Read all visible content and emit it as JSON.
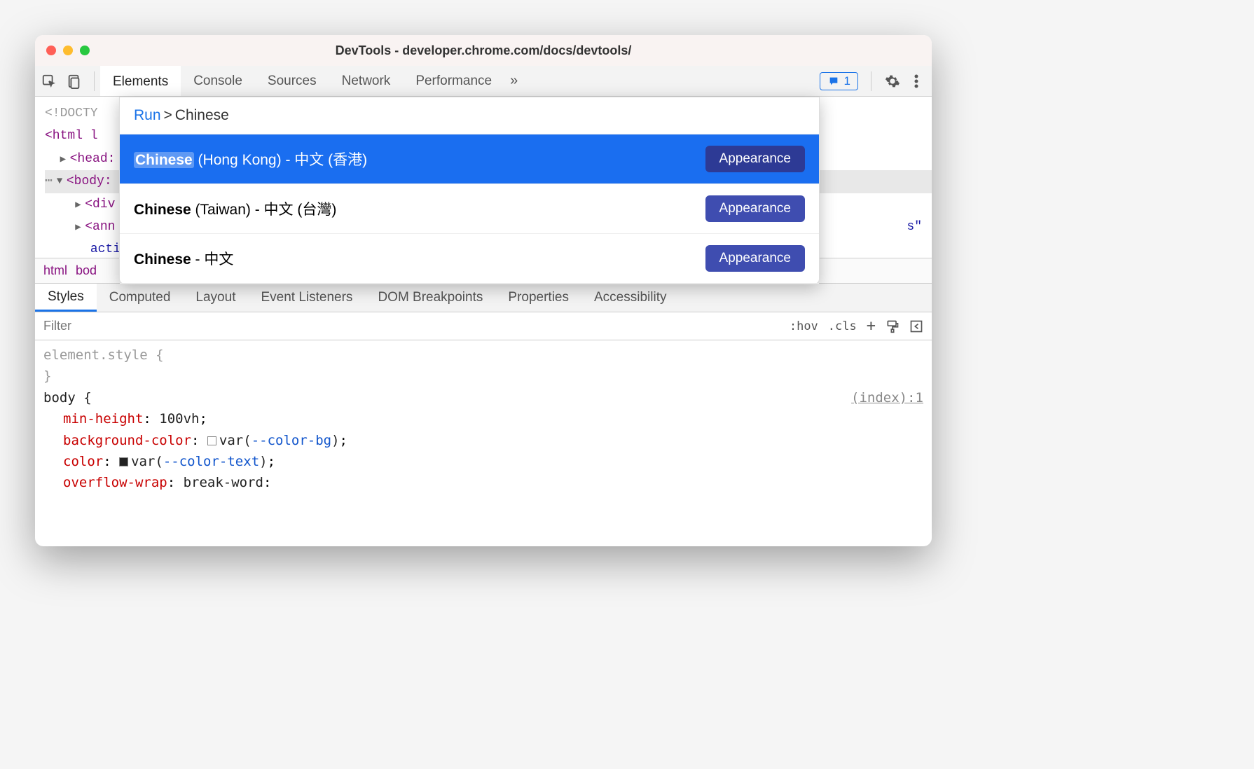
{
  "window": {
    "title": "DevTools - developer.chrome.com/docs/devtools/"
  },
  "toolbar": {
    "tabs": [
      "Elements",
      "Console",
      "Sources",
      "Network",
      "Performance"
    ],
    "active_tab": "Elements",
    "badge_count": "1"
  },
  "dom": {
    "doctype": "<!DOCTY",
    "html_open": "<html l",
    "head": "<head:",
    "body": "<body:",
    "div": "<div",
    "announcer": "<ann",
    "action": "acti",
    "attr_frag": "s\""
  },
  "breadcrumb": {
    "items": [
      "html",
      "bod"
    ]
  },
  "sub_tabs": [
    "Styles",
    "Computed",
    "Layout",
    "Event Listeners",
    "DOM Breakpoints",
    "Properties",
    "Accessibility"
  ],
  "sub_tab_active": "Styles",
  "filter": {
    "placeholder": "Filter",
    "hov": ":hov",
    "cls": ".cls"
  },
  "styles": {
    "element_style": "element.style {",
    "close": "}",
    "body_selector": "body {",
    "body_src": "(index):1",
    "rules": [
      {
        "name": "min-height",
        "value": "100vh"
      },
      {
        "name": "background-color",
        "var": "--color-bg",
        "swatch": "light"
      },
      {
        "name": "color",
        "var": "--color-text",
        "swatch": "dark"
      },
      {
        "name": "overflow-wrap",
        "value": "break-word"
      }
    ]
  },
  "command_menu": {
    "run_label": "Run",
    "prompt": ">",
    "query": "Chinese",
    "items": [
      {
        "bold": "Chinese",
        "rest": " (Hong Kong) - 中文 (香港)",
        "badge": "Appearance",
        "selected": true
      },
      {
        "bold": "Chinese",
        "rest": " (Taiwan) - 中文 (台灣)",
        "badge": "Appearance",
        "selected": false
      },
      {
        "bold": "Chinese",
        "rest": " - 中文",
        "badge": "Appearance",
        "selected": false
      }
    ]
  }
}
